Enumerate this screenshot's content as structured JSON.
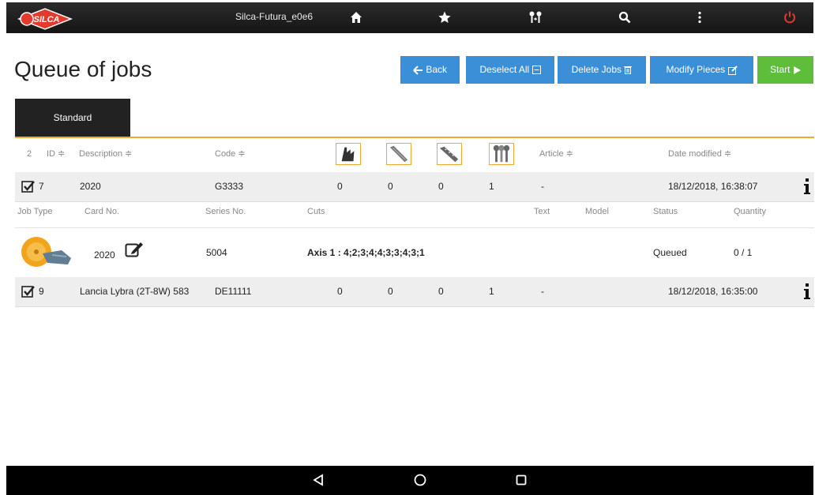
{
  "topbar": {
    "logo_text": "SILCA",
    "device_name": "Silca-Futura_e0e6",
    "icons": [
      "home-icon",
      "star-icon",
      "key-copy-icon",
      "search-icon",
      "more-vert-icon",
      "power-icon"
    ]
  },
  "page": {
    "title": "Queue of jobs"
  },
  "buttons": {
    "back": "Back",
    "deselect_all": "Deselect All",
    "delete_jobs": "Delete Jobs",
    "modify_pieces": "Modify Pieces",
    "start": "Start"
  },
  "tabs": [
    {
      "label": "Standard",
      "active": true
    }
  ],
  "table": {
    "count": "2",
    "headers": {
      "id": "ID ≑",
      "description": "Description ≑",
      "code": "Code ≑",
      "article": "Article ≑",
      "date_modified": "Date modified ≑"
    },
    "tool_icons": [
      "side-cutter-icon",
      "laser-key-icon",
      "dimple-key-icon",
      "cylinder-keys-icon"
    ],
    "sub_headers": {
      "job_type": "Job Type",
      "card_no": "Card No.",
      "series_no": "Series No.",
      "cuts": "Cuts",
      "text": "Text",
      "model": "Model",
      "status": "Status",
      "quantity": "Quantity"
    },
    "jobs": [
      {
        "id": "7",
        "description": "2020",
        "code": "G3333",
        "c1": "0",
        "c2": "0",
        "c3": "0",
        "c4": "1",
        "article": "-",
        "date": "18/12/2018, 16:38:07",
        "detail": {
          "card_no": "2020",
          "series_no": "5004",
          "cuts": "Axis 1 : 4;2;3;4;4;3;3;4;3;1",
          "status": "Queued",
          "quantity": "0 / 1"
        }
      },
      {
        "id": "9",
        "description": "Lancia Lybra (2T-8W) 583",
        "code": "DE11111",
        "c1": "0",
        "c2": "0",
        "c3": "0",
        "c4": "1",
        "article": "-",
        "date": "18/12/2018, 16:35:00"
      }
    ]
  },
  "colors": {
    "primary": "#3a8fd6",
    "start": "#5fbd3c",
    "accent": "#f0a830",
    "power": "#e53935"
  },
  "navbar": {
    "icons": [
      "back-triangle-icon",
      "home-circle-icon",
      "recents-square-icon"
    ]
  }
}
